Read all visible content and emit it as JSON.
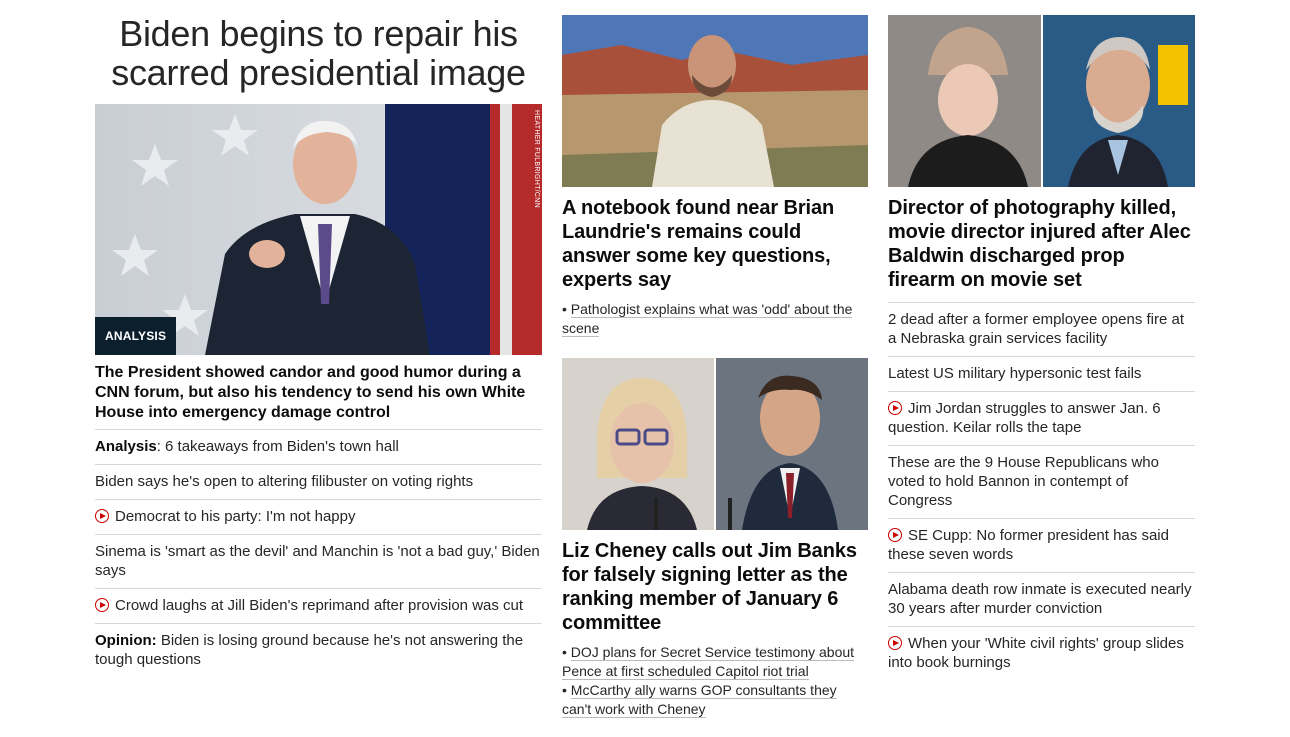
{
  "left": {
    "headline": "Biden begins to repair his scarred presidential image",
    "badge": "ANALYSIS",
    "photo_credit": "HEATHER FULBRIGHT/CNN",
    "lede": "The President showed candor and good humor during a CNN forum, but also his tendency to send his own White House into emergency damage control",
    "items": [
      {
        "prefix": "Analysis",
        "sep": ":",
        "text": " 6 takeaways from Biden's town hall",
        "video": false
      },
      {
        "prefix": "",
        "sep": "",
        "text": "Biden says he's open to altering filibuster on voting rights",
        "video": false
      },
      {
        "prefix": "",
        "sep": "",
        "text": "Democrat to his party: I'm not happy",
        "video": true
      },
      {
        "prefix": "",
        "sep": "",
        "text": "Sinema is 'smart as the devil' and Manchin is 'not a bad guy,' Biden says",
        "video": false
      },
      {
        "prefix": "",
        "sep": "",
        "text": "Crowd laughs at Jill Biden's reprimand after provision was cut",
        "video": true
      },
      {
        "prefix": "Opinion:",
        "sep": "",
        "text": " Biden is losing ground because he's not answering the tough questions",
        "video": false
      }
    ]
  },
  "middle": {
    "story1": {
      "title": "A notebook found near Brian Laundrie's remains could answer some key questions, experts say",
      "subs": [
        "Pathologist explains what was 'odd' about the scene"
      ]
    },
    "story2": {
      "title": "Liz Cheney calls out Jim Banks for falsely signing letter as the ranking member of January 6 committee",
      "subs": [
        "DOJ plans for Secret Service testimony about Pence at first scheduled Capitol riot trial",
        "McCarthy ally warns GOP consultants they can't work with Cheney"
      ]
    }
  },
  "right": {
    "title": "Director of photography killed, movie director injured after Alec Baldwin discharged prop firearm on movie set",
    "items": [
      {
        "text": "2 dead after a former employee opens fire at a Nebraska grain services facility",
        "video": false
      },
      {
        "text": "Latest US military hypersonic test fails",
        "video": false
      },
      {
        "text": "Jim Jordan struggles to answer Jan. 6 question. Keilar rolls the tape",
        "video": true
      },
      {
        "text": "These are the 9 House Republicans who voted to hold Bannon in contempt of Congress",
        "video": false
      },
      {
        "text": "SE Cupp: No former president has said these seven words",
        "video": true
      },
      {
        "text": "Alabama death row inmate is executed nearly 30 years after murder conviction",
        "video": false
      },
      {
        "text": "When your 'White civil rights' group slides into book burnings",
        "video": true
      }
    ]
  },
  "colors": {
    "accent_red": "#cc0000",
    "badge_bg": "#0c1f2c",
    "divider": "#d9d9d9"
  }
}
